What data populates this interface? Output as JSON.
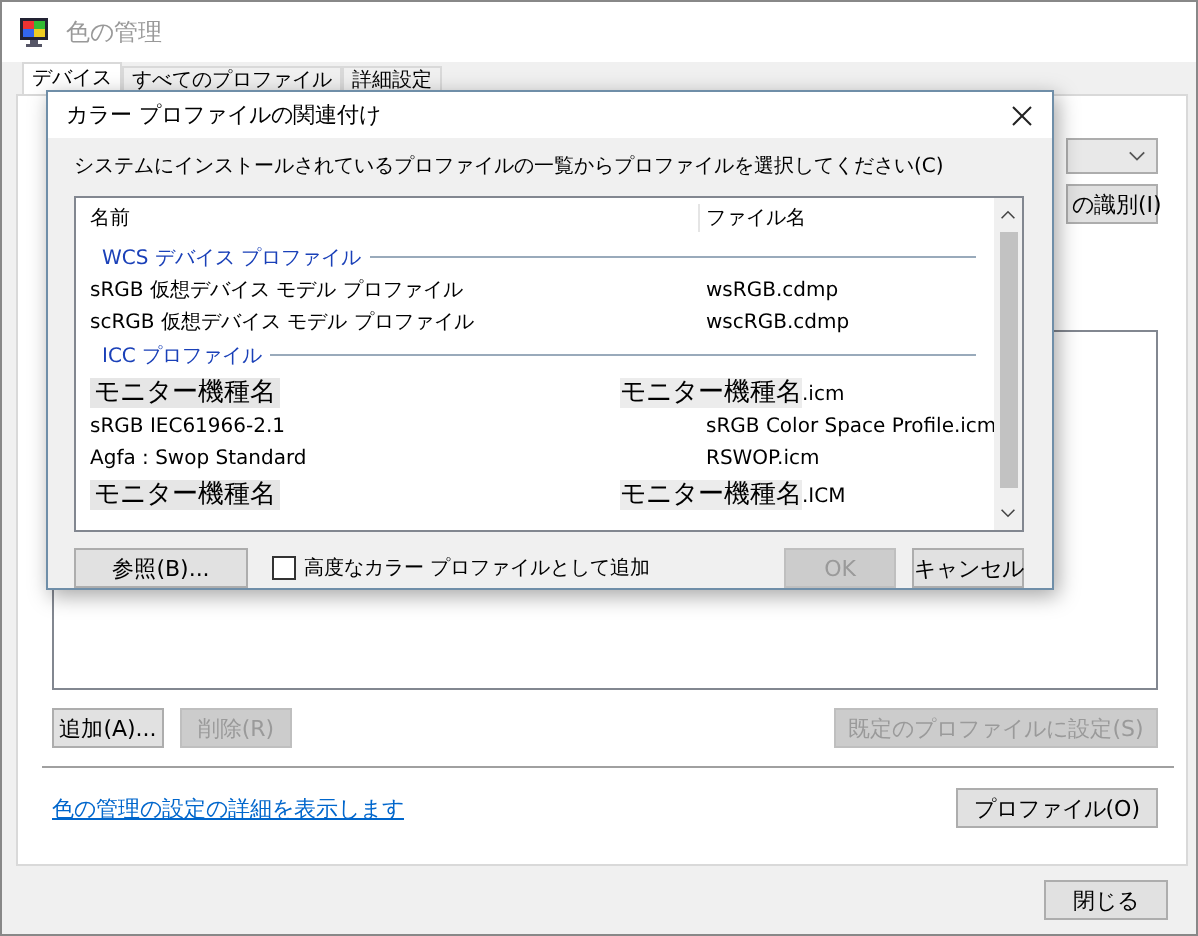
{
  "window": {
    "title": "色の管理",
    "active": false
  },
  "tabs": [
    {
      "label": "デバイス",
      "selected": true
    },
    {
      "label": "すべてのプロファイル",
      "selected": false
    },
    {
      "label": "詳細設定",
      "selected": false
    }
  ],
  "device_panel": {
    "identify_button": "の識別(I)",
    "add_button": "追加(A)...",
    "remove_button": {
      "label": "削除(R)",
      "disabled": true
    },
    "default_button": {
      "label": "既定のプロファイルに設定(S)",
      "disabled": true
    }
  },
  "link": "色の管理の設定の詳細を表示します",
  "profiles_button": "プロファイル(O)",
  "close_button": "閉じる",
  "dialog": {
    "title": "カラー プロファイルの関連付け",
    "instruction": "システムにインストールされているプロファイルの一覧からプロファイルを選択してください(C)",
    "columns": [
      "名前",
      "ファイル名"
    ],
    "rows": [
      {
        "kind": "group",
        "name": "WCS デバイス プロファイル"
      },
      {
        "kind": "item",
        "name": "sRGB 仮想デバイス モデル プロファイル",
        "file": "wsRGB.cdmp"
      },
      {
        "kind": "item",
        "name": "scRGB 仮想デバイス モデル プロファイル",
        "file": "wscRGB.cdmp"
      },
      {
        "kind": "group",
        "name": "ICC プロファイル"
      },
      {
        "kind": "redacted",
        "name": "モニター機種名",
        "file": "モニター機種名",
        "ext": ".icm"
      },
      {
        "kind": "item",
        "name": "sRGB IEC61966-2.1",
        "file": "sRGB Color Space Profile.icm"
      },
      {
        "kind": "item",
        "name": "Agfa : Swop Standard",
        "file": "RSWOP.icm"
      },
      {
        "kind": "redacted",
        "name": "モニター機種名",
        "file": "モニター機種名",
        "ext": ".ICM"
      }
    ],
    "browse_button": "参照(B)...",
    "advanced": {
      "label": "高度なカラー プロファイルとして追加",
      "checked": false
    },
    "ok_button": {
      "label": "OK",
      "disabled": true
    },
    "cancel_button": "キャンセル"
  }
}
